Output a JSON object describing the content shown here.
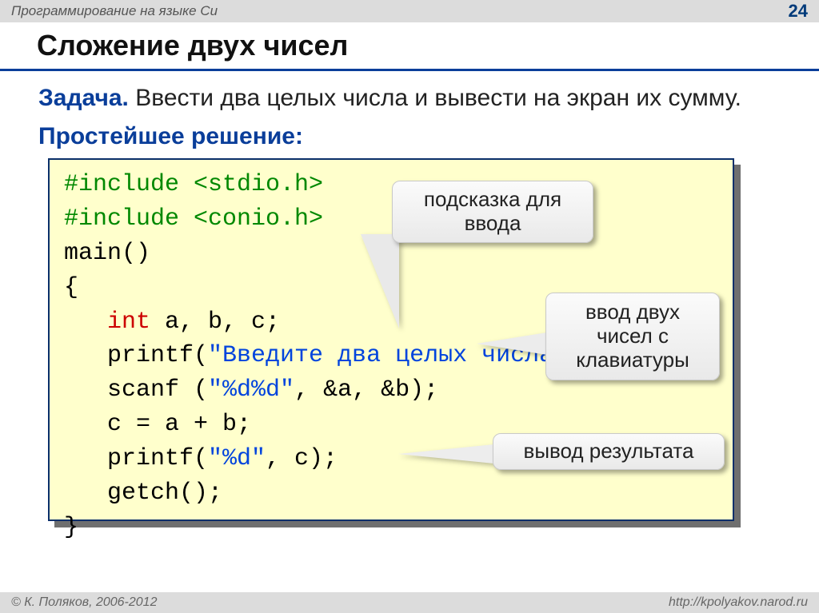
{
  "header": {
    "breadcrumb": "Программирование на языке Си",
    "page_number": "24"
  },
  "title": "Сложение двух чисел",
  "task": {
    "label": "Задача.",
    "text": " Ввести два целых числа и вывести на экран их сумму."
  },
  "solution_heading": "Простейшее решение:",
  "code": {
    "l1a": "#include ",
    "l1b": "<stdio.h>",
    "l2a": "#include ",
    "l2b": "<conio.h>",
    "l3": "main()",
    "l4": "{",
    "l5a": "   ",
    "l5b": "int",
    "l5c": " a, b, c;",
    "l6a": "   printf(",
    "l6b": "\"Введите два целых числа\\n\"",
    "l6c": ");",
    "l7a": "   scanf (",
    "l7b": "\"%d%d\"",
    "l7c": ", &a, &b);",
    "l8": "   c = a + b;",
    "l9a": "   printf(",
    "l9b": "\"%d\"",
    "l9c": ", c);",
    "l10": "   getch();",
    "l11": "}"
  },
  "callouts": {
    "hint_input": "подсказка для ввода",
    "read_two": "ввод двух чисел с клавиатуры",
    "output": "вывод результата"
  },
  "footer": {
    "copyright": "© К. Поляков, 2006-2012",
    "url": "http://kpolyakov.narod.ru"
  }
}
